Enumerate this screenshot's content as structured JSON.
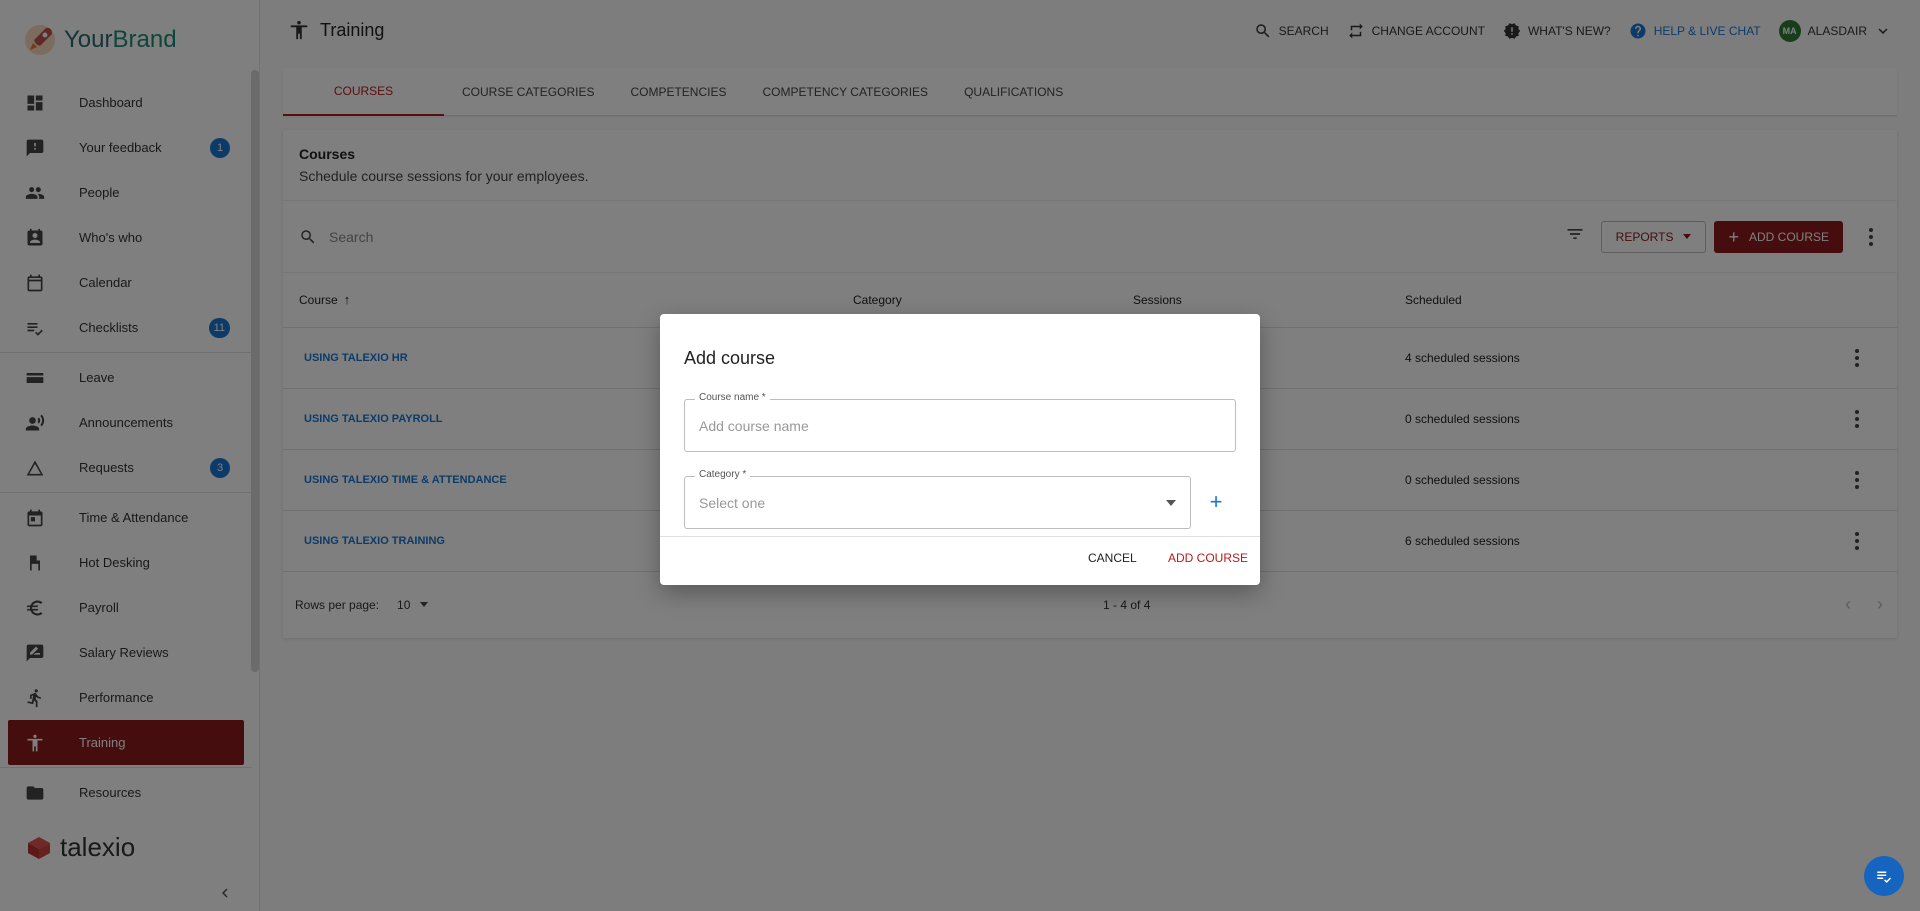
{
  "brand": {
    "name_part1": "Your",
    "name_part2": "Brand",
    "footer_logo": "talexio"
  },
  "sidebar": {
    "items": [
      {
        "label": "Dashboard",
        "icon": "dashboard-icon"
      },
      {
        "label": "Your feedback",
        "icon": "feedback-icon",
        "badge": "1"
      },
      {
        "label": "People",
        "icon": "people-icon"
      },
      {
        "label": "Who's who",
        "icon": "contact-card-icon"
      },
      {
        "label": "Calendar",
        "icon": "calendar-icon"
      },
      {
        "label": "Checklists",
        "icon": "checklist-icon",
        "badge": "11"
      },
      {
        "label": "Leave",
        "icon": "leave-icon"
      },
      {
        "label": "Announcements",
        "icon": "announcement-icon"
      },
      {
        "label": "Requests",
        "icon": "requests-icon",
        "badge": "3"
      },
      {
        "label": "Time & Attendance",
        "icon": "time-attendance-icon"
      },
      {
        "label": "Hot Desking",
        "icon": "hot-desking-icon"
      },
      {
        "label": "Payroll",
        "icon": "euro-icon"
      },
      {
        "label": "Salary Reviews",
        "icon": "salary-review-icon"
      },
      {
        "label": "Performance",
        "icon": "performance-icon"
      },
      {
        "label": "Training",
        "icon": "training-icon",
        "active": true
      },
      {
        "label": "Resources",
        "icon": "folder-icon"
      }
    ]
  },
  "header": {
    "title": "Training",
    "search": "Search",
    "change_account": "Change account",
    "whats_new": "What's new?",
    "help": "Help & live chat",
    "avatar_initials": "MA",
    "user": "ALASDAIR"
  },
  "tabs": [
    "Courses",
    "Course categories",
    "Competencies",
    "Competency categories",
    "Qualifications"
  ],
  "courses": {
    "title": "Courses",
    "subtitle": "Schedule course sessions for your employees.",
    "search_placeholder": "Search",
    "reports_label": "Reports",
    "add_label": "Add course",
    "columns": [
      "Course",
      "Category",
      "Sessions",
      "Scheduled"
    ],
    "rows": [
      {
        "course": "Using Talexio HR",
        "scheduled": "4 scheduled sessions"
      },
      {
        "course": "Using Talexio Payroll",
        "scheduled": "0 scheduled sessions"
      },
      {
        "course": "Using Talexio Time & Attendance",
        "scheduled": "0 scheduled sessions"
      },
      {
        "course": "Using Talexio Training",
        "scheduled": "6 scheduled sessions"
      }
    ],
    "rows_per_page_label": "Rows per page:",
    "rows_per_page": "10",
    "range": "1 - 4 of 4"
  },
  "modal": {
    "title": "Add course",
    "course_name_label": "Course name *",
    "course_name_placeholder": "Add course name",
    "category_label": "Category *",
    "category_placeholder": "Select one",
    "cancel": "Cancel",
    "submit": "Add course"
  },
  "colors": {
    "accent": "#8b1a1a",
    "link": "#1976d2",
    "badge": "#1976d2"
  }
}
